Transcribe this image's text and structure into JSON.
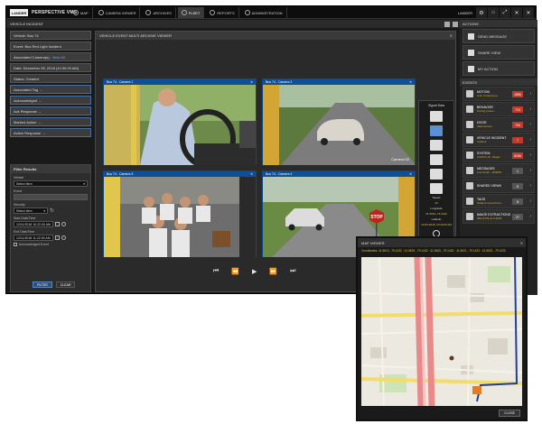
{
  "app": {
    "logo_text": "LANDER",
    "title": "PERSPECTIVE VMS",
    "nav": [
      {
        "label": "MAP",
        "icon": "globe-icon"
      },
      {
        "label": "CAMERA VIEWER",
        "icon": "monitor-icon"
      },
      {
        "label": "ARCHIVES",
        "icon": "archive-icon"
      },
      {
        "label": "FLEET",
        "icon": "bus-icon"
      },
      {
        "label": "REPORTS",
        "icon": "report-icon"
      },
      {
        "label": "ADMINISTRATION",
        "icon": "wrench-icon"
      }
    ],
    "active_nav": 3,
    "user": "LANDER",
    "window_buttons": [
      "⚙",
      "⌂",
      "⤢",
      "✕",
      "✕"
    ]
  },
  "incident": {
    "header": "VEHICLE INCIDENT",
    "fields": [
      {
        "label": "Vehicle: Bus 74"
      },
      {
        "label": "Event: Bus Red Light Incident"
      },
      {
        "label": "Associated Camera(s):",
        "link": "View All"
      },
      {
        "label": "Date: December 05, 2018 (10:30:00 AM)"
      },
      {
        "label": "Status: Created"
      },
      {
        "label": "Associated Tag →"
      },
      {
        "label": "Acknowledged →"
      },
      {
        "label": "Ack Response →"
      },
      {
        "label": "Marked Action →"
      },
      {
        "label": "Action Response →"
      }
    ]
  },
  "filter": {
    "header": "Filter Results",
    "vehicle_label": "Vehicle",
    "vehicle_value": "Select Item",
    "event_label": "Event",
    "security_label": "Security",
    "security_value": "Select Item",
    "start_label": "Start Date/Time",
    "start_value": "12/11/2018 10:22:00 AM",
    "end_label": "End Date/Time",
    "end_value": "12/11/2018 11:22:00 AM",
    "ack_label": "Acknowledged Event",
    "filter_btn": "FILTER",
    "clear_btn": "CLEAR"
  },
  "main": {
    "header": "VEHICLE EVENT MULTI ARCHIVE VIEWER",
    "cameras": [
      {
        "label": "Bus 74 - Camera 1"
      },
      {
        "label": "Bus 74 - Camera 2"
      },
      {
        "label": "Bus 74 - Camera 3"
      },
      {
        "label": "Bus 74 - Camera 4"
      }
    ],
    "overlay_text": "Camera 02",
    "signal_title": "Signal Data",
    "speed_label": "Speed",
    "speed_value": "23",
    "longitude_label": "Longitude",
    "longitude_value": "41.5619,-79.1432",
    "latitude_label": "Latitude",
    "latitude_value": "12-05-2018, 10:30:00 AM",
    "controls": [
      "⏮",
      "⏪",
      "▶",
      "⏩",
      "⏭"
    ]
  },
  "actions": {
    "header": "ACTIONS",
    "items": [
      {
        "label": "SEND MESSAGE",
        "icon": "message-icon"
      },
      {
        "label": "SHARE VIEW",
        "icon": "share-icon"
      },
      {
        "label": "MY ACTION",
        "icon": "lightning-icon"
      }
    ]
  },
  "events": {
    "header": "EVENTS",
    "items": [
      {
        "title": "MOTION",
        "sub": "Unit: Conference...",
        "badge": "1856",
        "alert": true
      },
      {
        "title": "BEHAVIOR",
        "sub": "Driving preser...",
        "badge": "713",
        "alert": true
      },
      {
        "title": "DOOR",
        "sub": "Valid access",
        "badge": "705",
        "alert": true
      },
      {
        "title": "VEHICLE INCIDENT",
        "sub": "Incident",
        "badge": "7",
        "alert": true
      },
      {
        "title": "SYSTEM",
        "sub": "CASUS 18 - Illegal ...",
        "badge": "8156",
        "alert": true
      },
      {
        "title": "MESSAGES",
        "sub": "Lisa Smith - ZD3651",
        "badge": "1",
        "alert": false
      },
      {
        "title": "SHARED VIEWS",
        "sub": "",
        "badge": "8",
        "alert": false
      },
      {
        "title": "TAGS",
        "sub": "Student record fram...",
        "badge": "8",
        "alert": false
      },
      {
        "title": "IMAGE EXTRACTIONS",
        "sub": "IMG-8726 as 3.2018",
        "badge": "27",
        "alert": false
      }
    ]
  },
  "map": {
    "header": "MAP VIEWER",
    "coords": "Coordinates: 41.5619, -79.1432 · 41.5619, -79.1432 · 41.5620, -79.1432 · 41.5621, -79.1433 · 41.5622, -79.1433",
    "close_btn": "CLOSE"
  },
  "colors": {
    "accent": "#0e4f9a",
    "alert": "#c0392b",
    "highlight": "#d6b22a"
  }
}
